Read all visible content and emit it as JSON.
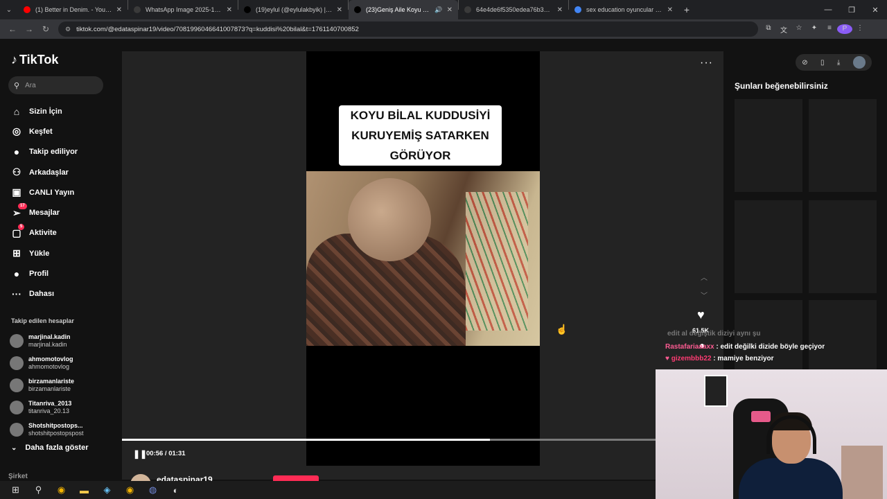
{
  "browser": {
    "tabs": [
      {
        "title": "(1) Better in Denim. - YouTube",
        "favicon_color": "#ff0000",
        "active": false
      },
      {
        "title": "WhatsApp Image 2025-10-22 a",
        "favicon_color": "#3a3a3a",
        "active": false
      },
      {
        "title": "(19)eylul (@eylulakbyik) | TikTo",
        "favicon_color": "#000000",
        "active": false
      },
      {
        "title": "(23)Geniş Aile Koyu Bilal Ku",
        "favicon_color": "#000000",
        "active": true
      },
      {
        "title": "64e4de6f5350edea76b3215102",
        "favicon_color": "#3a3a3a",
        "active": false
      },
      {
        "title": "sex education oyuncular - Goo",
        "favicon_color": "#4285f4",
        "active": false
      }
    ],
    "url": "tiktok.com/@edataspinar19/video/7081996046641007873?q=kuddisi%20bilal&t=1761140700852",
    "profile_initial": "P"
  },
  "sidebar": {
    "logo": "TikTok",
    "search_placeholder": "Ara",
    "nav": [
      {
        "label": "Sizin İçin",
        "icon": "home-icon",
        "glyph": "⌂"
      },
      {
        "label": "Keşfet",
        "icon": "compass-icon",
        "glyph": "◎"
      },
      {
        "label": "Takip ediliyor",
        "icon": "following-avatar-icon",
        "glyph": "●"
      },
      {
        "label": "Arkadaşlar",
        "icon": "friends-icon",
        "glyph": "⚇"
      },
      {
        "label": "CANLI Yayın",
        "icon": "live-icon",
        "glyph": "▣"
      },
      {
        "label": "Mesajlar",
        "icon": "messages-icon",
        "glyph": "➢",
        "badge": "17"
      },
      {
        "label": "Aktivite",
        "icon": "activity-icon",
        "glyph": "▢",
        "badge": "5"
      },
      {
        "label": "Yükle",
        "icon": "upload-icon",
        "glyph": "⊞"
      },
      {
        "label": "Profil",
        "icon": "profile-avatar-icon",
        "glyph": "●"
      },
      {
        "label": "Dahası",
        "icon": "more-icon",
        "glyph": "···"
      }
    ],
    "following_title": "Takip edilen hesaplar",
    "following": [
      {
        "name": "marjinal.kadin",
        "handle": "marjinal.kadin"
      },
      {
        "name": "ahmomotovlog",
        "handle": "ahmomotovlog"
      },
      {
        "name": "birzamanlariste",
        "handle": "birzamanlariste"
      },
      {
        "name": "Titanriva_2013",
        "handle": "titanriva_20.13"
      },
      {
        "name": "Shotshitpostops...",
        "handle": "shotshitpostopspost"
      }
    ],
    "show_more": "Daha fazla göster",
    "company": "Şirket"
  },
  "video": {
    "caption": "KOYU BİLAL KUDDUSİYİ KURUYEMİŞ SATARKEN GÖRÜYOR",
    "like_count": "61.5K",
    "progress": 0.69,
    "time": "00:56 / 01:31",
    "author": "edataspinar19"
  },
  "suggestions": {
    "title": "Şunları beğenebilirsiniz"
  },
  "stream_chat": {
    "faded_line": "edit al değiştik diziyi aynı şu",
    "lines": [
      {
        "user": "Rastafariaaaxx",
        "text": ": edit değilki dizide böyle geçiyor"
      },
      {
        "user": "gizembbb22",
        "text": ": mamiye benziyor"
      }
    ]
  }
}
